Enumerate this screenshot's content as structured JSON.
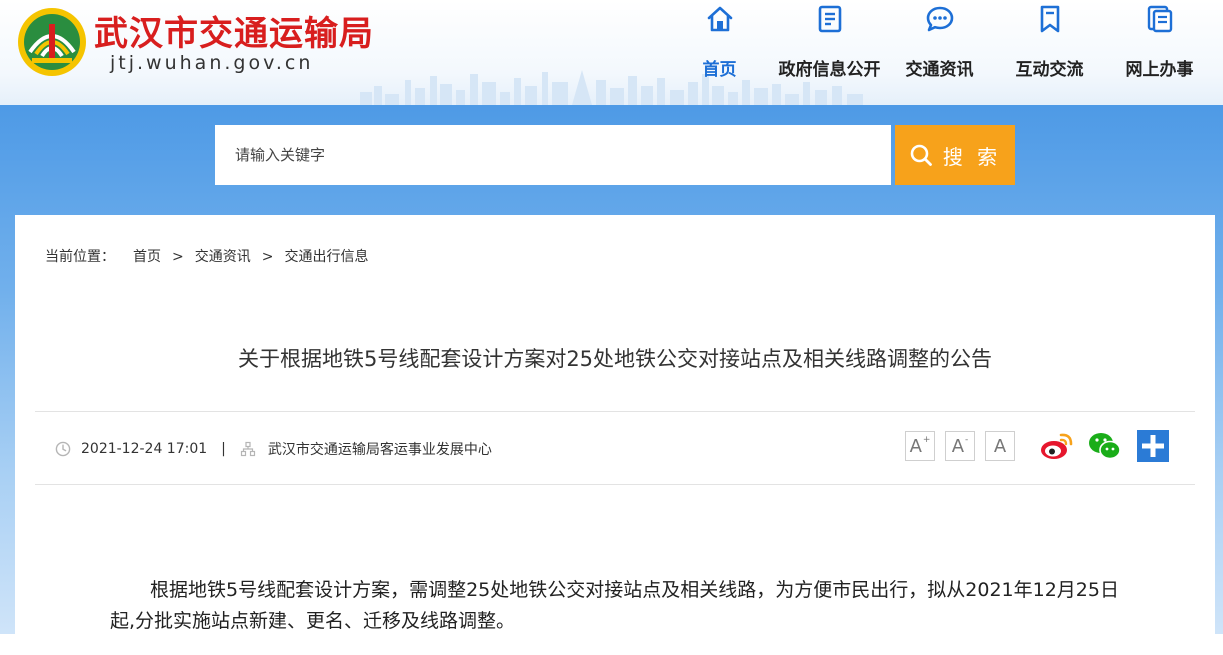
{
  "site": {
    "title": "武汉市交通运输局",
    "domain": "jtj.wuhan.gov.cn"
  },
  "nav": [
    {
      "label": "首页",
      "icon": "home-icon",
      "active": true
    },
    {
      "label": "政府信息公开",
      "icon": "document-icon",
      "active": false
    },
    {
      "label": "交通资讯",
      "icon": "chat-bubble-icon",
      "active": false
    },
    {
      "label": "互动交流",
      "icon": "bookmark-icon",
      "active": false
    },
    {
      "label": "网上办事",
      "icon": "files-icon",
      "active": false
    }
  ],
  "search": {
    "placeholder": "请输入关键字",
    "button_label": "搜 索"
  },
  "breadcrumb": {
    "prefix": "当前位置：",
    "items": [
      "首页",
      "交通资讯",
      "交通出行信息"
    ],
    "separator": ">"
  },
  "article": {
    "title": "关于根据地铁5号线配套设计方案对25处地铁公交对接站点及相关线路调整的公告",
    "date": "2021-12-24 17:01",
    "meta_separator": "|",
    "source": "武汉市交通运输局客运事业发展中心",
    "body": "根据地铁5号线配套设计方案，需调整25处地铁公交对接站点及相关线路，为方便市民出行，拟从2021年12月25日起,分批实施站点新建、更名、迁移及线路调整。"
  },
  "font_controls": [
    {
      "label": "A",
      "suffix": "+"
    },
    {
      "label": "A",
      "suffix": "-"
    },
    {
      "label": "A",
      "suffix": ""
    }
  ],
  "share": [
    "weibo-icon",
    "wechat-icon",
    "more-share-icon"
  ],
  "colors": {
    "brand_red": "#d81e1e",
    "nav_active": "#1d6fd6",
    "search_button": "#f7a21b",
    "banner_blue": "#4e9ae6",
    "weibo": "#e6162d",
    "wechat": "#1aad19",
    "share_plus": "#2b7bd6"
  }
}
